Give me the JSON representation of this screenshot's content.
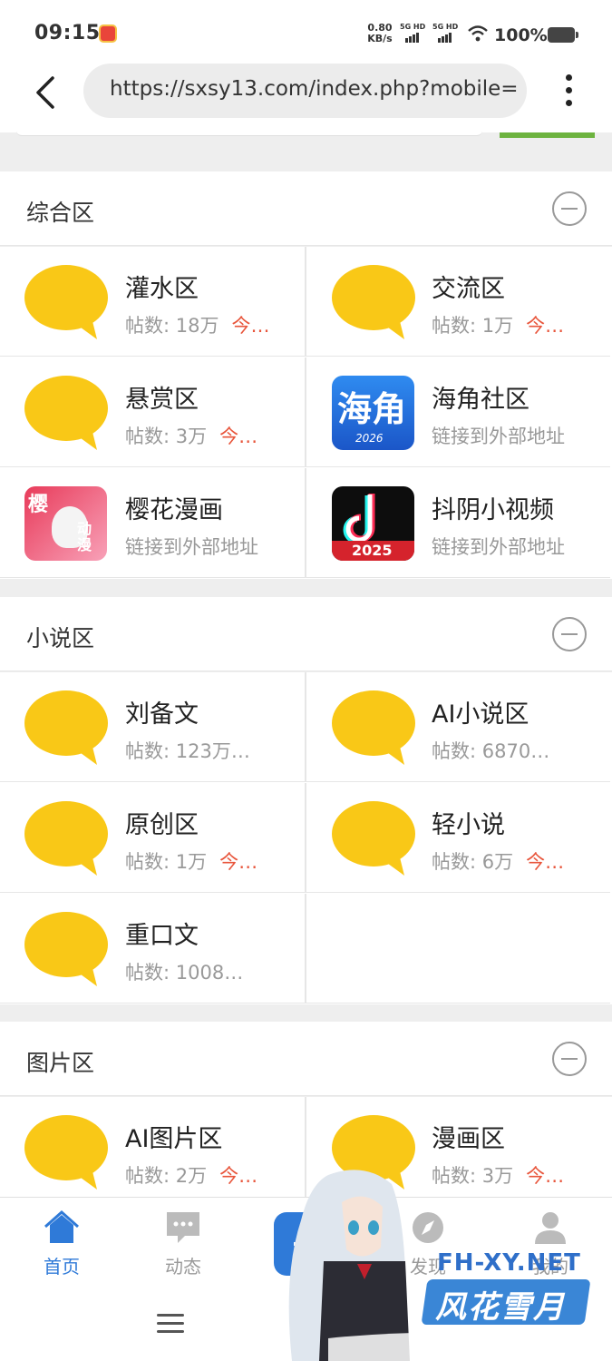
{
  "status_bar": {
    "time": "09:15",
    "speed_value": "0.80",
    "speed_unit": "KB/s",
    "net1": "5G HD",
    "net2": "5G HD",
    "battery": "100%"
  },
  "browser": {
    "url": "https://sxsy13.com/index.php?mobile="
  },
  "sections": [
    {
      "title": "综合区",
      "forums": [
        {
          "name": "灌水区",
          "posts_label": "帖数: 18万",
          "today_label": "今…",
          "icon": "speech-bubble"
        },
        {
          "name": "交流区",
          "posts_label": "帖数: 1万",
          "today_label": "今…",
          "icon": "speech-bubble"
        },
        {
          "name": "悬赏区",
          "posts_label": "帖数: 3万",
          "today_label": "今…",
          "icon": "speech-bubble"
        },
        {
          "name": "海角社区",
          "posts_label": "链接到外部地址",
          "icon": "haijiao-app-logo",
          "logo_text": "海角",
          "logo_year": "2026"
        },
        {
          "name": "樱花漫画",
          "posts_label": "链接到外部地址",
          "icon": "sakura-manga-app-logo",
          "logo_text": "樱",
          "logo_text2": "动漫"
        },
        {
          "name": "抖阴小视频",
          "posts_label": "链接到外部地址",
          "icon": "douyin-app-logo",
          "logo_year": "2025"
        }
      ]
    },
    {
      "title": "小说区",
      "forums": [
        {
          "name": "刘备文",
          "posts_label": "帖数: 123万…",
          "icon": "speech-bubble"
        },
        {
          "name": "AI小说区",
          "posts_label": "帖数: 6870…",
          "icon": "speech-bubble"
        },
        {
          "name": "原创区",
          "posts_label": "帖数: 1万",
          "today_label": "今…",
          "icon": "speech-bubble"
        },
        {
          "name": "轻小说",
          "posts_label": "帖数: 6万",
          "today_label": "今…",
          "icon": "speech-bubble"
        },
        {
          "name": "重口文",
          "posts_label": "帖数: 1008…",
          "icon": "speech-bubble"
        }
      ]
    },
    {
      "title": "图片区",
      "forums": [
        {
          "name": "AI图片区",
          "posts_label": "帖数: 2万",
          "today_label": "今…",
          "icon": "speech-bubble"
        },
        {
          "name": "漫画区",
          "posts_label": "帖数: 3万",
          "today_label": "今…",
          "icon": "speech-bubble"
        }
      ]
    }
  ],
  "tabbar": {
    "home": "首页",
    "feed": "动态",
    "discover": "发现",
    "me": "我的"
  },
  "watermark": {
    "site": "FH-XY.NET",
    "name": "风花雪月"
  },
  "colors": {
    "accent": "#2f7ad8",
    "bubble": "#f9c817",
    "today": "#e8553b"
  }
}
